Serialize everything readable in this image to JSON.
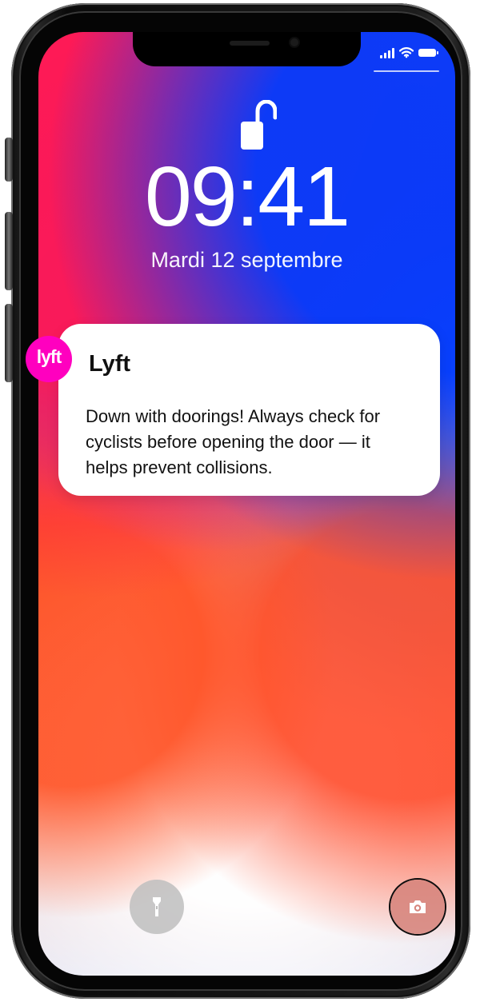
{
  "status_bar": {
    "icons": [
      "signal-icon",
      "wifi-icon",
      "battery-icon"
    ]
  },
  "lock_screen": {
    "time": "09:41",
    "date": "Mardi 12 septembre",
    "lock_icon": "unlocked-padlock-icon"
  },
  "notification": {
    "app_icon_text": "lyft",
    "app_name": "Lyft",
    "message": "Down with doorings! Always check for cyclists before opening the door — it helps prevent collisions."
  },
  "bottom_actions": {
    "left_icon": "flashlight-icon",
    "right_icon": "camera-icon"
  },
  "colors": {
    "lyft_accent": "#ff00bf",
    "notification_background": "#ffffff",
    "lock_screen_text": "#ffffff"
  }
}
